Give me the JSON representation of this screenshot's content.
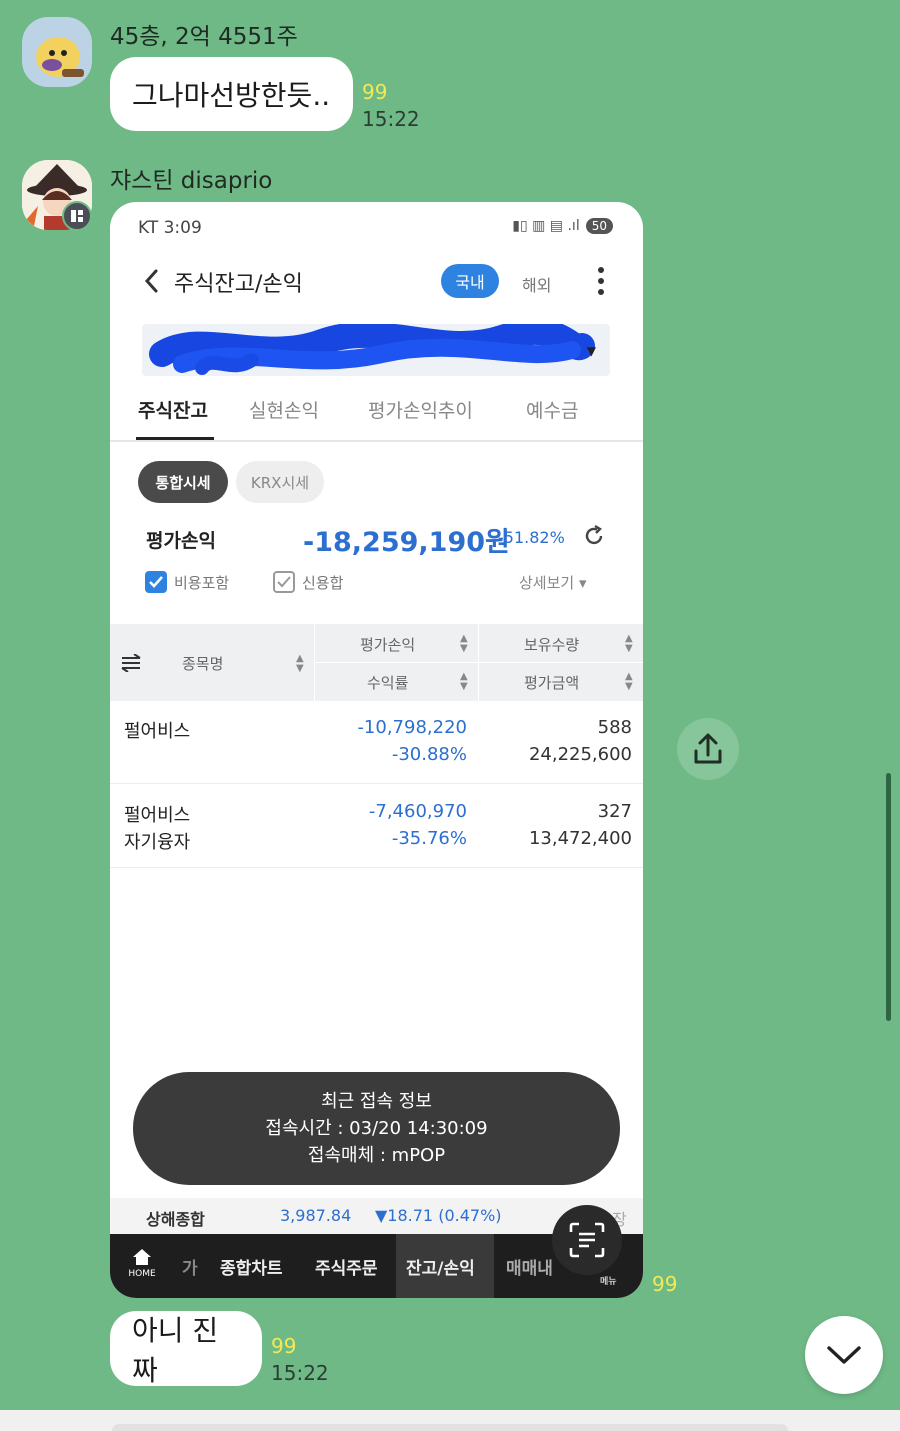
{
  "messages": [
    {
      "sender": "45층, 2억 4551주",
      "text": "그나마선방한듯..",
      "unread": "99",
      "time": "15:22"
    },
    {
      "sender": "쟈스틴 disaprio",
      "image_unread": "99",
      "image": {
        "status": {
          "carrier_time": "KT 3:09",
          "battery": "50"
        },
        "appbar": {
          "title": "주식잔고/손익",
          "domestic": "국내",
          "foreign": "해외"
        },
        "tabs": [
          "주식잔고",
          "실현손익",
          "평가손익추이",
          "예수금"
        ],
        "segments": [
          "통합시세",
          "KRX시세"
        ],
        "profit_loss": {
          "label": "평가손익",
          "value": "-18,259,190원",
          "rate": "-51.82%"
        },
        "options": {
          "fee_included": "비용포함",
          "credit_total": "신용합",
          "detail": "상세보기"
        },
        "table": {
          "headers": {
            "name": "종목명",
            "pl": "평가손익",
            "rate": "수익률",
            "qty": "보유수량",
            "eval": "평가금액"
          },
          "rows": [
            {
              "name": "펄어비스",
              "name2": "",
              "pl": "-10,798,220",
              "rate": "-30.88%",
              "qty": "588",
              "eval": "24,225,600"
            },
            {
              "name": "펄어비스",
              "name2": "자기융자",
              "pl": "-7,460,970",
              "rate": "-35.76%",
              "qty": "327",
              "eval": "13,472,400"
            }
          ]
        },
        "toast": {
          "title": "최근 접속 정보",
          "time": "접속시간 : 03/20 14:30:09",
          "medium": "접속매체 : mPOP"
        },
        "ticker": {
          "index": "상해종합",
          "value": "3,987.84",
          "change": "▼18.71 (0.47%)",
          "trail": "장"
        },
        "bottom_nav": {
          "home": "HOME",
          "item0": "가",
          "item1": "종합차트",
          "item2": "주식주문",
          "item3": "잔고/손익",
          "item4": "매매내",
          "menu": "메뉴"
        }
      }
    },
    {
      "text": "아니 진짜",
      "unread": "99",
      "time": "15:22"
    }
  ],
  "colors": {
    "chat_bg": "#6fb987",
    "unread": "#f2ea54",
    "accent_blue": "#2c6fcf"
  },
  "icons": [
    "share-icon",
    "chevron-down-icon",
    "scan-text-icon",
    "home-icon",
    "refresh-icon",
    "back-icon",
    "more-icon"
  ]
}
